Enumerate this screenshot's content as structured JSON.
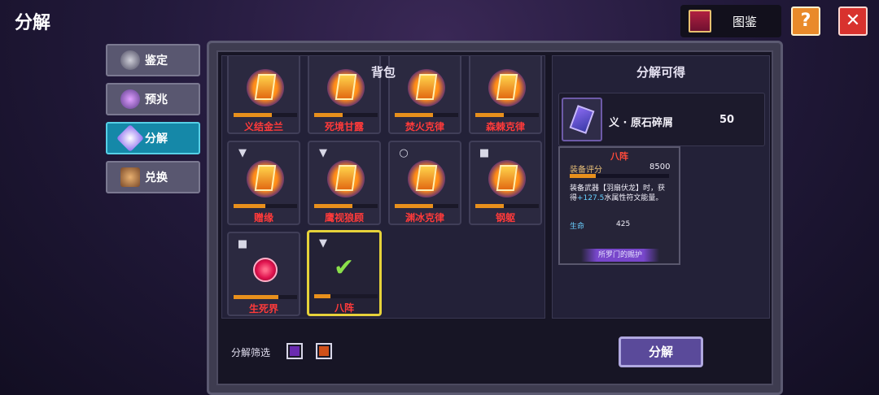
{
  "header": {
    "title": "分解",
    "codex_label": "图鉴",
    "help_label": "?",
    "close_label": "✕"
  },
  "tabs": [
    {
      "label": "鉴定",
      "active": false,
      "icon": "appraise-icon"
    },
    {
      "label": "预兆",
      "active": false,
      "icon": "omen-icon"
    },
    {
      "label": "分解",
      "active": true,
      "icon": "decompose-icon"
    },
    {
      "label": "兑换",
      "active": false,
      "icon": "exchange-icon"
    }
  ],
  "bag": {
    "title": "背包",
    "items": [
      {
        "name": "义结金兰",
        "type": "rune",
        "progress": 0.6
      },
      {
        "name": "死境甘露",
        "type": "rune",
        "progress": 0.45
      },
      {
        "name": "焚火克律",
        "type": "rune",
        "progress": 0.6
      },
      {
        "name": "森棘克律",
        "type": "rune",
        "progress": 0.45
      },
      {
        "name": "赠缘",
        "type": "rune",
        "slot_icon": "weapon-slot-icon",
        "progress": 0.5
      },
      {
        "name": "鹰视狼顾",
        "type": "rune",
        "slot_icon": "weapon-slot-icon",
        "progress": 0.6
      },
      {
        "name": "渊冰克律",
        "type": "rune",
        "slot_icon": "ring-slot-icon",
        "progress": 0.6
      },
      {
        "name": "钢躯",
        "type": "rune",
        "slot_icon": "armor-slot-icon",
        "progress": 0.45
      },
      {
        "name": "生死界",
        "type": "orb",
        "slot_icon": "armor-slot-icon",
        "progress": 0.7
      },
      {
        "name": "八阵",
        "type": "selected",
        "slot_icon": "weapon-slot-icon",
        "progress": 0.26
      }
    ]
  },
  "result": {
    "title": "分解可得",
    "item_name": "义 · 原石碎屑",
    "count": "50"
  },
  "tooltip": {
    "title": "八阵",
    "score_label": "装备评分",
    "score_value": "8500",
    "score_fill": 0.26,
    "desc_line1": "装备武器【羽扇伏龙】时，获",
    "desc_prefix": "得",
    "desc_highlight": "+127.5",
    "desc_suffix": "水属性符文能量。",
    "hp_label": "生命",
    "hp_value": "425",
    "set_label": "所罗门的赐护"
  },
  "filter": {
    "label": "分解筛选",
    "colors": [
      "#6a2ab0",
      "#d0501a"
    ]
  },
  "decompose_button": "分解"
}
